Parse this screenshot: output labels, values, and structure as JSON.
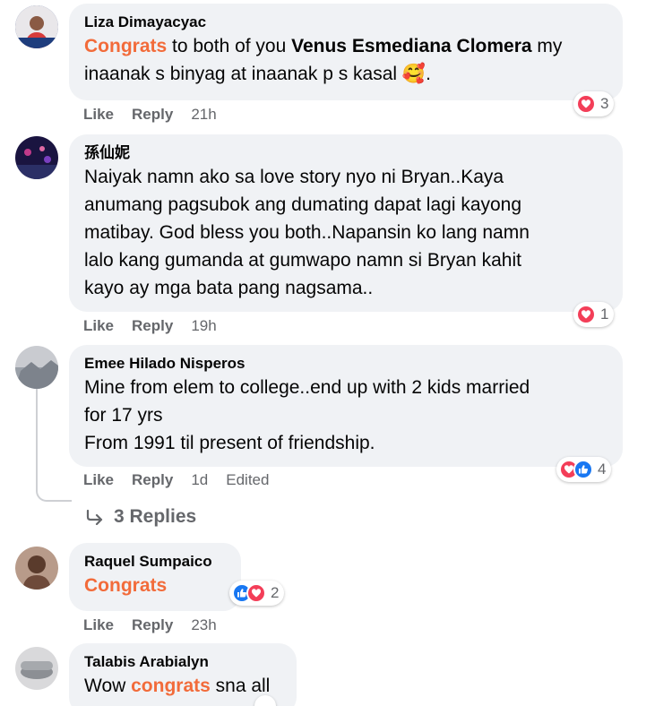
{
  "comments": [
    {
      "author": "Liza Dimayacyac",
      "text_parts": [
        "Congrats",
        " to both of you ",
        "Venus Esmediana Clomera",
        " my inaanak s binyag at inaanak p s kasal ",
        "🥰",
        "."
      ],
      "like": "Like",
      "reply": "Reply",
      "time": "21h",
      "reaction_count": "3"
    },
    {
      "author": "孫仙妮",
      "text": "Naiyak namn ako sa love story nyo ni Bryan..Kaya anumang pagsubok ang dumating dapat lagi kayong matibay. God bless you both..Napansin ko lang namn lalo kang gumanda at gumwapo namn si Bryan kahit kayo ay mga bata pang nagsama..",
      "lines": [
        "Naiyak namn ako sa love story nyo ni Bryan..Kaya",
        "anumang pagsubok ang dumating dapat lagi kayong",
        "matibay. God bless you both..Napansin ko lang namn",
        "lalo kang gumanda at gumwapo namn si Bryan kahit",
        "kayo ay mga bata pang nagsama.."
      ],
      "like": "Like",
      "reply": "Reply",
      "time": "19h",
      "reaction_count": "1"
    },
    {
      "author": "Emee Hilado Nisperos",
      "lines": [
        "Mine from elem to college..end up with 2 kids married",
        "for 17 yrs",
        "From 1991 til present of friendship."
      ],
      "like": "Like",
      "reply": "Reply",
      "time": "1d",
      "edited": "Edited",
      "reaction_count": "4",
      "replies_label": "3 Replies"
    },
    {
      "author": "Raquel Sumpaico",
      "text": "Congrats",
      "like": "Like",
      "reply": "Reply",
      "time": "23h",
      "reaction_count": "2"
    },
    {
      "author": "Talabis Arabialyn",
      "text_parts": [
        "Wow ",
        "congrats",
        " sna all"
      ]
    }
  ],
  "colors": {
    "highlight": "#f26b3a",
    "bubble": "#f0f2f5",
    "meta": "#65676b",
    "heart": "#f33e58",
    "like": "#1877f2"
  },
  "icons": [
    "heart-reaction-icon",
    "like-reaction-icon",
    "reply-arrow-icon"
  ]
}
